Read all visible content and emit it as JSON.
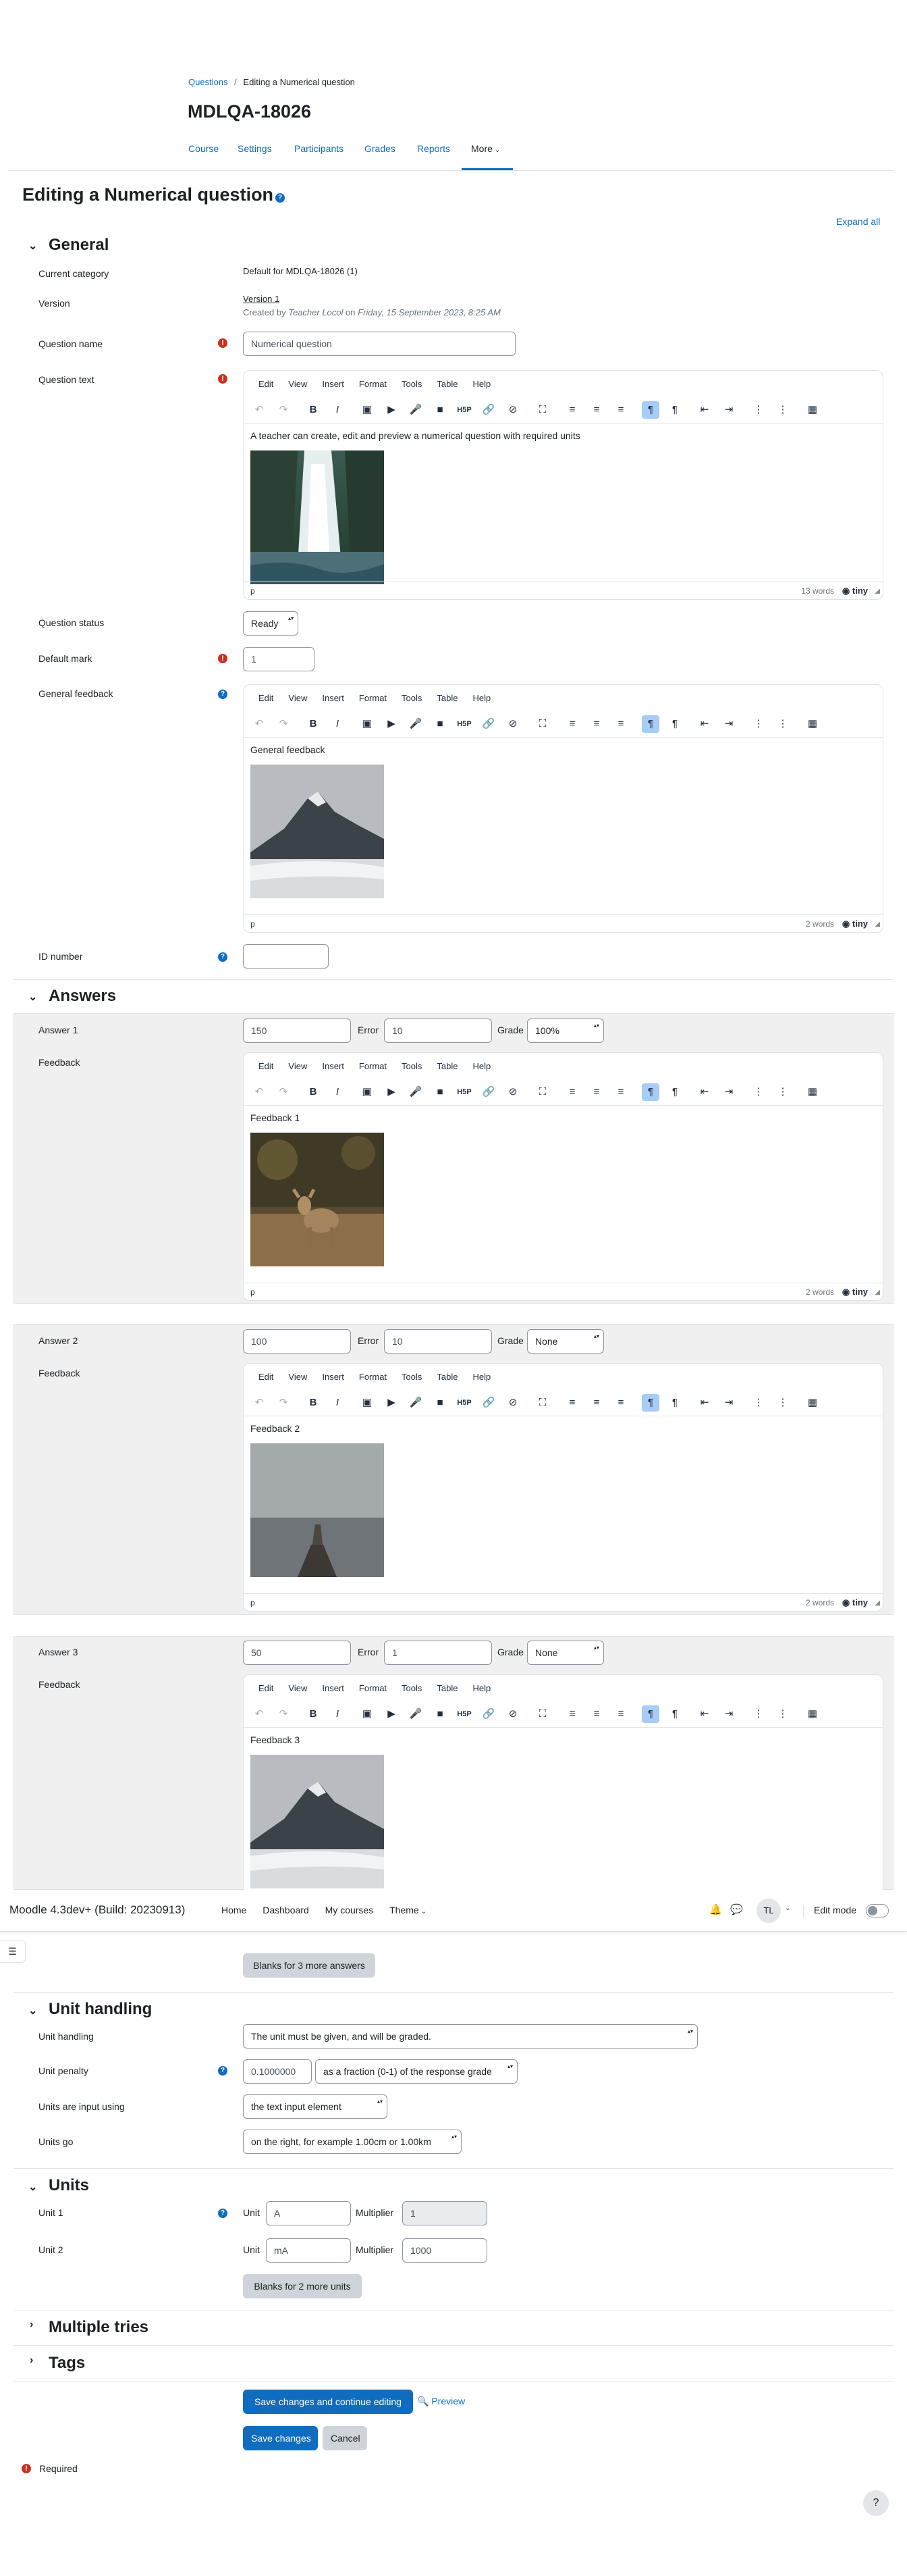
{
  "breadcrumb": {
    "link": "Questions",
    "sep": "/",
    "current": "Editing a Numerical question"
  },
  "course_title": "MDLQA-18026",
  "tabs": [
    {
      "label": "Course"
    },
    {
      "label": "Settings"
    },
    {
      "label": "Participants"
    },
    {
      "label": "Grades"
    },
    {
      "label": "Reports"
    },
    {
      "label": "More"
    }
  ],
  "page_heading": "Editing a Numerical question",
  "expand_all": "Expand all",
  "general": {
    "heading": "General",
    "current_category_label": "Current category",
    "current_category_value": "Default for MDLQA-18026 (1)",
    "version_label": "Version",
    "version_value": "Version 1",
    "version_created_prefix": "Created by",
    "version_author": "Teacher Locol",
    "version_on": "on",
    "version_date": "Friday, 15 September 2023, 8:25 AM",
    "question_name_label": "Question name",
    "question_name_value": "Numerical question",
    "question_text_label": "Question text",
    "question_text_value": "A teacher can create, edit and preview a numerical question with required units",
    "question_text_words": "13 words",
    "question_status_label": "Question status",
    "question_status_value": "Ready",
    "default_mark_label": "Default mark",
    "default_mark_value": "1",
    "general_feedback_label": "General feedback",
    "general_feedback_value": "General feedback",
    "general_feedback_words": "2 words",
    "id_number_label": "ID number",
    "id_number_value": ""
  },
  "editor": {
    "menu": [
      "Edit",
      "View",
      "Insert",
      "Format",
      "Tools",
      "Table",
      "Help"
    ],
    "path": "p",
    "brand": "tiny"
  },
  "answers": {
    "heading": "Answers",
    "error_label": "Error",
    "grade_label": "Grade",
    "feedback_label": "Feedback",
    "items": [
      {
        "label": "Answer 1",
        "answer": "150",
        "error": "10",
        "grade": "100%",
        "feedback": "Feedback 1",
        "words": "2 words"
      },
      {
        "label": "Answer 2",
        "answer": "100",
        "error": "10",
        "grade": "None",
        "feedback": "Feedback 2",
        "words": "2 words"
      },
      {
        "label": "Answer 3",
        "answer": "50",
        "error": "1",
        "grade": "None",
        "feedback": "Feedback 3",
        "words": ""
      }
    ],
    "blanks_button": "Blanks for 3 more answers"
  },
  "navbar": {
    "brand": "Moodle 4.3dev+ (Build: 20230913)",
    "links": [
      "Home",
      "Dashboard",
      "My courses",
      "Theme"
    ],
    "avatar": "TL",
    "edit_mode": "Edit mode"
  },
  "unit_handling": {
    "heading": "Unit handling",
    "unit_handling_label": "Unit handling",
    "unit_handling_value": "The unit must be given, and will be graded.",
    "unit_penalty_label": "Unit penalty",
    "unit_penalty_value": "0.1000000",
    "unit_penalty_mode": "as a fraction (0-1) of the response grade",
    "units_input_label": "Units are input using",
    "units_input_value": "the text input element",
    "units_go_label": "Units go",
    "units_go_value": "on the right, for example 1.00cm or 1.00km"
  },
  "units": {
    "heading": "Units",
    "unit_label": "Unit",
    "multiplier_label": "Multiplier",
    "items": [
      {
        "label": "Unit 1",
        "unit": "A",
        "multiplier": "1"
      },
      {
        "label": "Unit 2",
        "unit": "mA",
        "multiplier": "1000"
      }
    ],
    "blanks_button": "Blanks for 2 more units"
  },
  "multiple_tries": {
    "heading": "Multiple tries"
  },
  "tags": {
    "heading": "Tags"
  },
  "actions": {
    "save_continue": "Save changes and continue editing",
    "preview": "Preview",
    "save": "Save changes",
    "cancel": "Cancel"
  },
  "required_note": "Required",
  "help_button": "?",
  "colors": {
    "primary": "#0f6cbf",
    "required": "#ca3120",
    "panel": "#f0f0f0"
  }
}
